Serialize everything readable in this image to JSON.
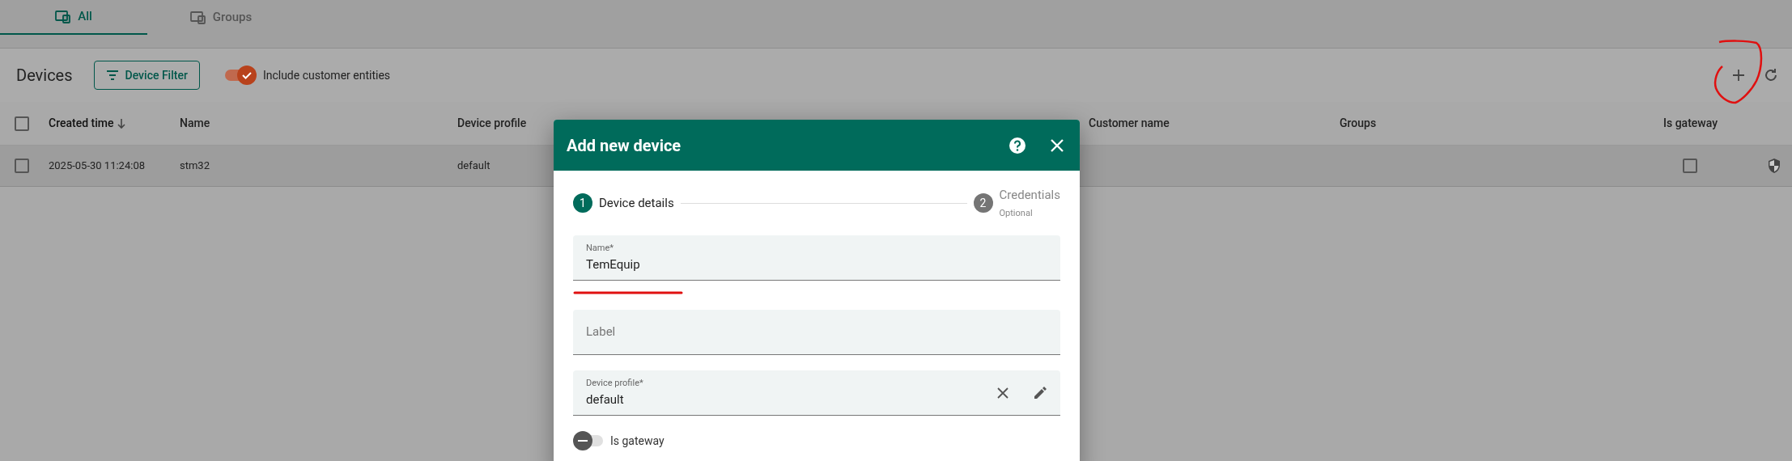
{
  "tabs": [
    {
      "label": "All",
      "selected": true
    },
    {
      "label": "Groups",
      "selected": false
    }
  ],
  "toolbar": {
    "title": "Devices",
    "filter_button": "Device Filter",
    "include_customer": {
      "label": "Include customer entities",
      "on": true
    }
  },
  "table": {
    "select_all_checked": false,
    "columns": [
      {
        "label": "Created time",
        "sorted": true
      },
      {
        "label": "Name",
        "sorted": false
      },
      {
        "label": "Device profile",
        "sorted": false
      },
      {
        "label": "Customer name",
        "sorted": false
      },
      {
        "label": "Groups",
        "sorted": false
      },
      {
        "label": "Is gateway",
        "sorted": false
      }
    ],
    "rows": [
      {
        "checked": false,
        "created_time": "2025-05-30 11:24:08",
        "name": "stm32",
        "device_profile": "default",
        "is_gateway": false
      }
    ]
  },
  "dialog": {
    "title": "Add new device",
    "steps": [
      {
        "number": "1",
        "label": "Device details",
        "selected": true
      },
      {
        "number": "2",
        "label": "Credentials",
        "sublabel": "Optional",
        "selected": false
      }
    ],
    "fields": [
      {
        "kind": "text",
        "label": "Name*",
        "value": "TemEquip"
      },
      {
        "kind": "text",
        "placeholder": "Label"
      },
      {
        "kind": "autocomplete",
        "label": "Device profile*",
        "value": "default"
      }
    ],
    "gateway": {
      "label": "Is gateway",
      "on": false
    }
  }
}
